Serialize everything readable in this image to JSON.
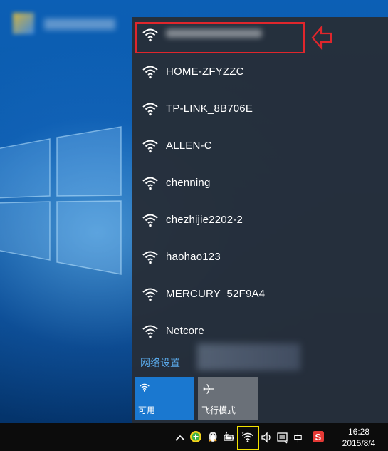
{
  "networks": [
    {
      "ssid": ""
    },
    {
      "ssid": "HOME-ZFYZZC"
    },
    {
      "ssid": "TP-LINK_8B706E"
    },
    {
      "ssid": "ALLEN-C"
    },
    {
      "ssid": "chenning"
    },
    {
      "ssid": "chezhijie2202-2"
    },
    {
      "ssid": "haohao123"
    },
    {
      "ssid": "MERCURY_52F9A4"
    },
    {
      "ssid": "Netcore"
    }
  ],
  "network_settings_label": "网络设置",
  "quick_actions": {
    "wifi_label": "可用",
    "airplane_label": "飞行模式"
  },
  "taskbar": {
    "ime_label": "中",
    "time": "16:28",
    "date": "2015/8/4"
  },
  "colors": {
    "accent": "#1a78d0",
    "highlight": "#e0262c",
    "link": "#5aa9ea"
  }
}
